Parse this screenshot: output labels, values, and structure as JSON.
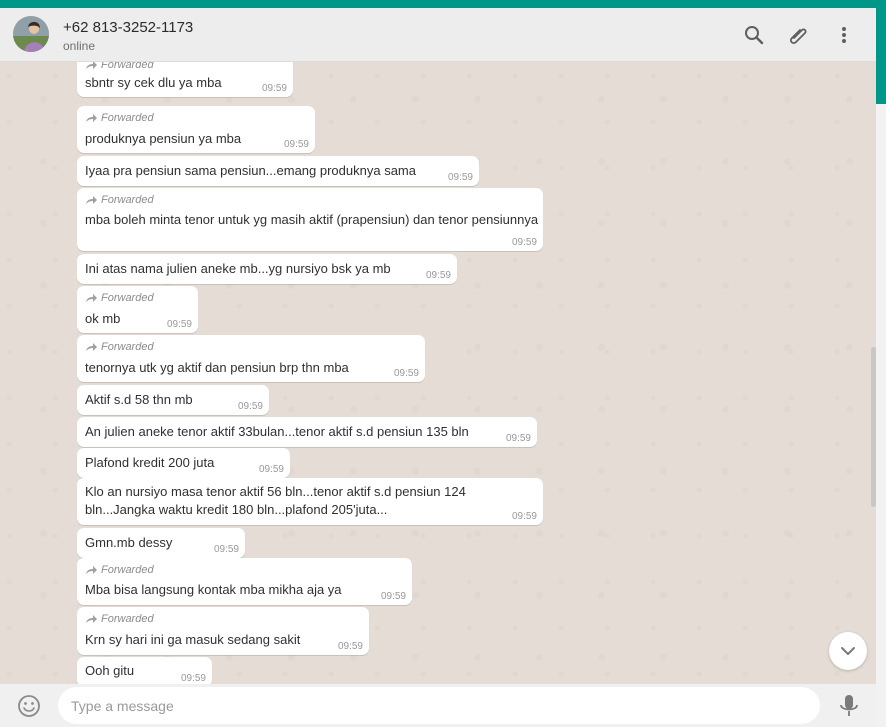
{
  "header": {
    "contact_name": "+62 813-3252-1173",
    "status": "online",
    "icons": [
      "search-icon",
      "attach-icon",
      "menu-icon"
    ]
  },
  "messages": [
    {
      "forwarded": true,
      "forward_label": "Forwarded",
      "text": "sbntr sy cek dlu ya mba",
      "time": "09:59"
    },
    {
      "forwarded": true,
      "forward_label": "Forwarded",
      "text": "produknya pensiun ya mba",
      "time": "09:59"
    },
    {
      "forwarded": false,
      "text": "Iyaa pra pensiun sama pensiun...emang produknya sama",
      "time": "09:59"
    },
    {
      "forwarded": true,
      "forward_label": "Forwarded",
      "text": "mba boleh minta tenor untuk yg masih aktif (prapensiun) dan tenor pensiunnya",
      "time": "09:59"
    },
    {
      "forwarded": false,
      "text": "Ini atas nama julien aneke mb...yg nursiyo bsk ya mb",
      "time": "09:59"
    },
    {
      "forwarded": true,
      "forward_label": "Forwarded",
      "text": "ok mb",
      "time": "09:59"
    },
    {
      "forwarded": true,
      "forward_label": "Forwarded",
      "text": "tenornya utk yg aktif dan pensiun brp thn mba",
      "time": "09:59"
    },
    {
      "forwarded": false,
      "text": "Aktif s.d 58 thn mb",
      "time": "09:59"
    },
    {
      "forwarded": false,
      "text": "An julien aneke tenor aktif 33bulan...tenor aktif s.d pensiun 135 bln",
      "time": "09:59"
    },
    {
      "forwarded": false,
      "text": "Plafond kredit 200 juta",
      "time": "09:59"
    },
    {
      "forwarded": false,
      "text": "Klo an nursiyo masa tenor aktif 56 bln...tenor aktif s.d pensiun 124 bln...Jangka waktu kredit 180 bln...plafond 205'juta...",
      "time": "09:59"
    },
    {
      "forwarded": false,
      "text": "Gmn.mb dessy",
      "time": "09:59"
    },
    {
      "forwarded": true,
      "forward_label": "Forwarded",
      "text": "Mba bisa langsung kontak mba mikha aja ya",
      "time": "09:59"
    },
    {
      "forwarded": true,
      "forward_label": "Forwarded",
      "text": "Krn sy hari ini ga masuk sedang sakit",
      "time": "09:59"
    },
    {
      "forwarded": false,
      "text": "Ooh gitu",
      "time": "09:59"
    }
  ],
  "composer": {
    "placeholder": "Type a message",
    "value": "",
    "icons": [
      "emoji-icon",
      "mic-icon"
    ]
  },
  "colors": {
    "accent": "#009688",
    "chat_background": "#e5ddd5",
    "bubble": "#ffffff",
    "header": "#ededed"
  }
}
